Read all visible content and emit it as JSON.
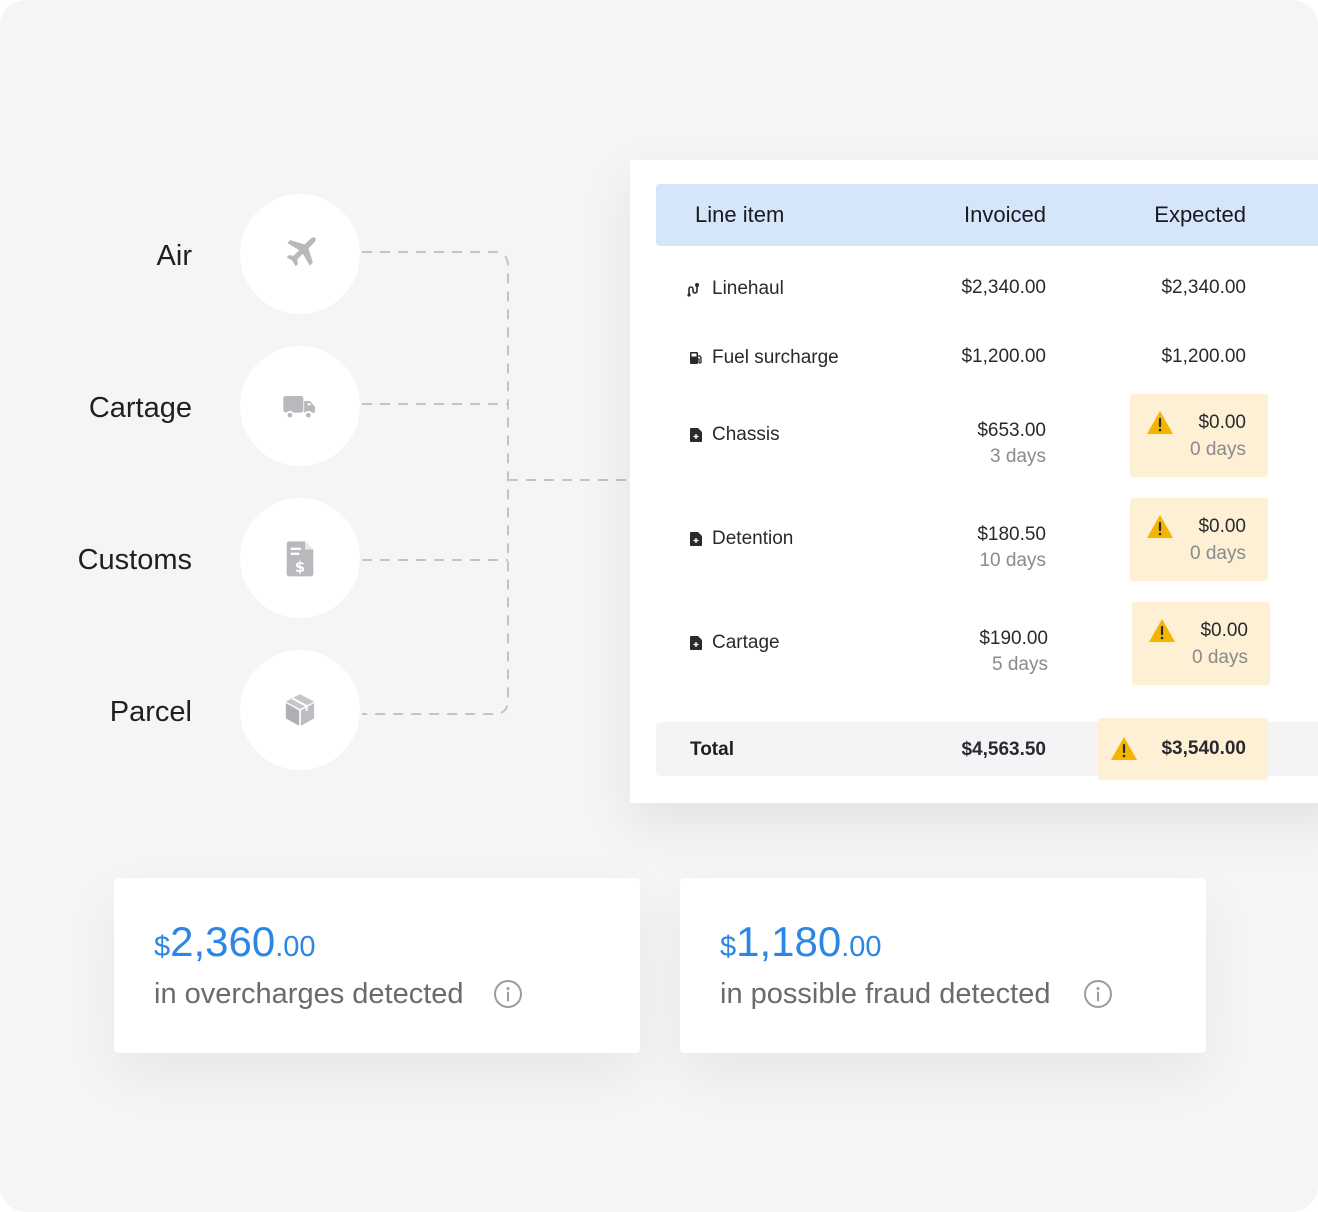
{
  "modes": [
    {
      "label": "Air",
      "icon": "airplane-icon"
    },
    {
      "label": "Cartage",
      "icon": "truck-icon"
    },
    {
      "label": "Customs",
      "icon": "invoice-dollar-icon"
    },
    {
      "label": "Parcel",
      "icon": "package-icon"
    }
  ],
  "table": {
    "headers": {
      "line_item": "Line item",
      "invoiced": "Invoiced",
      "expected": "Expected"
    },
    "rows": [
      {
        "label": "Linehaul",
        "icon": "route-icon",
        "invoiced": "$2,340.00",
        "expected": "$2,340.00"
      },
      {
        "label": "Fuel surcharge",
        "icon": "fuel-pump-icon",
        "invoiced": "$1,200.00",
        "expected": "$1,200.00"
      },
      {
        "label": "Chassis",
        "icon": "document-plus-icon",
        "invoiced": "$653.00",
        "invoiced_days": "3 days",
        "expected": "$0.00",
        "expected_days": "0 days",
        "flagged": true
      },
      {
        "label": "Detention",
        "icon": "document-plus-icon",
        "invoiced": "$180.50",
        "invoiced_days": "10 days",
        "expected": "$0.00",
        "expected_days": "0 days",
        "flagged": true
      },
      {
        "label": "Cartage",
        "icon": "document-plus-icon",
        "invoiced": "$190.00",
        "invoiced_days": "5 days",
        "expected": "$0.00",
        "expected_days": "0 days",
        "flagged": true
      }
    ],
    "total": {
      "label": "Total",
      "invoiced": "$4,563.50",
      "expected": "$3,540.00"
    }
  },
  "stats": [
    {
      "currency": "$",
      "whole": "2,360",
      "cents": ".00",
      "description": "in overcharges detected"
    },
    {
      "currency": "$",
      "whole": "1,180",
      "cents": ".00",
      "description": "in possible fraud detected"
    }
  ],
  "colors": {
    "accent_blue": "#2b86e6",
    "header_bg": "#d5e6fb",
    "warning_bg": "#fdf0d4",
    "warning_icon": "#f5b400",
    "icon_gray": "#b9b9bd"
  }
}
